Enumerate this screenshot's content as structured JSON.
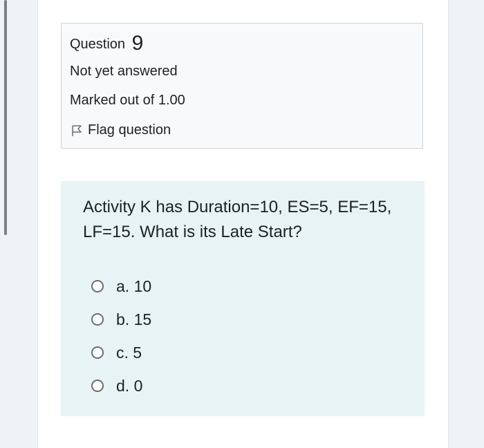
{
  "question_info": {
    "label": "Question",
    "number": "9",
    "state": "Not yet answered",
    "grade": "Marked out of 1.00",
    "flag_label": "Flag question"
  },
  "question": {
    "text": "Activity K has Duration=10, ES=5, EF=15, LF=15. What is its Late Start?",
    "answers": [
      {
        "text": "a. 10"
      },
      {
        "text": "b. 15"
      },
      {
        "text": "c. 5"
      },
      {
        "text": "d. 0"
      }
    ]
  },
  "colors": {
    "info_bg": "#f8f9fa",
    "question_bg": "#e7f3f5",
    "text": "#1d2125"
  }
}
